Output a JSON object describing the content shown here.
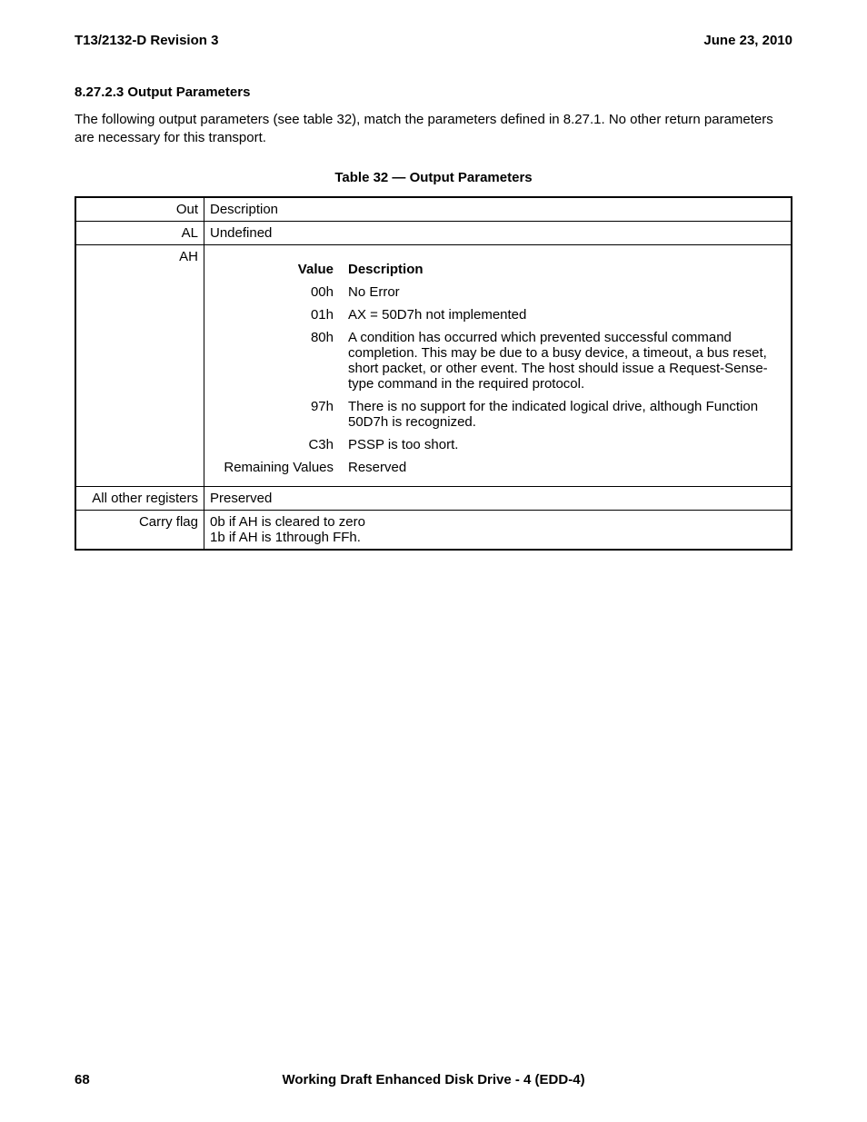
{
  "header": {
    "doc_id": "T13/2132-D Revision 3",
    "date": "June 23, 2010"
  },
  "section": {
    "heading": "8.27.2.3 Output Parameters",
    "paragraph": "The following output parameters (see table 32), match the parameters defined in 8.27.1.  No other return parameters are necessary for this transport."
  },
  "table": {
    "caption": "Table 32 — Output Parameters",
    "header_cells": [
      "Out",
      "Description"
    ],
    "rows": {
      "al": {
        "label": "AL",
        "desc": "Undefined"
      },
      "ah": {
        "label": "AH",
        "inner_headers": [
          "Value",
          "Description"
        ],
        "inner_rows": [
          {
            "value": "00h",
            "desc": "No Error"
          },
          {
            "value": "01h",
            "desc": "AX = 50D7h not implemented"
          },
          {
            "value": "80h",
            "desc": "A condition has occurred which prevented successful command completion.  This may be due to a busy device, a timeout, a bus reset, short packet, or other event.  The host should issue a Request-Sense-type command in the required protocol."
          },
          {
            "value": "97h",
            "desc": "There is no support for the indicated logical drive, although Function 50D7h is recognized."
          },
          {
            "value": "C3h",
            "desc": "PSSP is too short."
          },
          {
            "value": "Remaining Values",
            "desc": "Reserved"
          }
        ]
      },
      "other_regs": {
        "label": "All other registers",
        "desc": "Preserved"
      },
      "carry_flag": {
        "label": "Carry flag",
        "line1": "0b if AH is cleared to zero",
        "line2": "1b if AH is 1through FFh."
      }
    }
  },
  "footer": {
    "page_number": "68",
    "title": "Working Draft Enhanced Disk Drive - 4  (EDD-4)"
  },
  "chart_data": {
    "type": "table",
    "title": "Table 32 — Output Parameters",
    "columns": [
      "Out",
      "Description"
    ],
    "rows": [
      [
        "AL",
        "Undefined"
      ],
      [
        "AH",
        [
          [
            "Value",
            "Description"
          ],
          [
            "00h",
            "No Error"
          ],
          [
            "01h",
            "AX = 50D7h not implemented"
          ],
          [
            "80h",
            "A condition has occurred which prevented successful command completion. This may be due to a busy device, a timeout, a bus reset, short packet, or other event. The host should issue a Request-Sense-type command in the required protocol."
          ],
          [
            "97h",
            "There is no support for the indicated logical drive, although Function 50D7h is recognized."
          ],
          [
            "C3h",
            "PSSP is too short."
          ],
          [
            "Remaining Values",
            "Reserved"
          ]
        ]
      ],
      [
        "All other registers",
        "Preserved"
      ],
      [
        "Carry flag",
        "0b if AH is cleared to zero; 1b if AH is 1 through FFh."
      ]
    ]
  }
}
